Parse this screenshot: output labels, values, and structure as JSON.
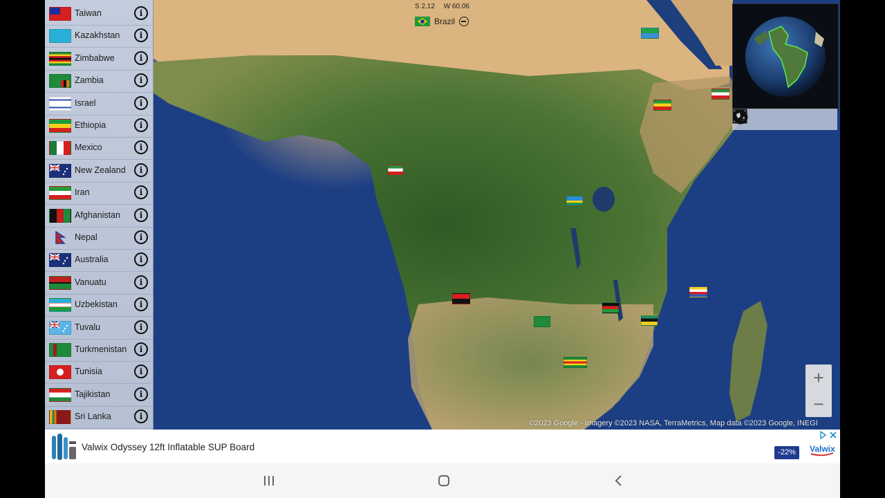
{
  "sidebar": {
    "countries": [
      {
        "name": "Taiwan",
        "flag": "taiwan-flag"
      },
      {
        "name": "Kazakhstan",
        "flag": "kazakhstan-flag"
      },
      {
        "name": "Zimbabwe",
        "flag": "zimbabwe-flag"
      },
      {
        "name": "Zambia",
        "flag": "zambia-flag"
      },
      {
        "name": "Israel",
        "flag": "israel-flag"
      },
      {
        "name": "Ethiopia",
        "flag": "ethiopia-flag"
      },
      {
        "name": "Mexico",
        "flag": "mexico-flag"
      },
      {
        "name": "New Zealand",
        "flag": "new-zealand-flag"
      },
      {
        "name": "Iran",
        "flag": "iran-flag"
      },
      {
        "name": "Afghanistan",
        "flag": "afghanistan-flag"
      },
      {
        "name": "Nepal",
        "flag": "nepal-flag"
      },
      {
        "name": "Australia",
        "flag": "australia-flag"
      },
      {
        "name": "Vanuatu",
        "flag": "vanuatu-flag"
      },
      {
        "name": "Uzbekistan",
        "flag": "uzbekistan-flag"
      },
      {
        "name": "Tuvalu",
        "flag": "tuvalu-flag"
      },
      {
        "name": "Turkmenistan",
        "flag": "turkmenistan-flag"
      },
      {
        "name": "Tunisia",
        "flag": "tunisia-flag"
      },
      {
        "name": "Tajikistan",
        "flag": "tajikistan-flag"
      },
      {
        "name": "Sri Lanka",
        "flag": "sri-lanka-flag"
      }
    ],
    "info_icon": "info-icon"
  },
  "coords": {
    "lat": "S 2.12",
    "lon": "W 60.06"
  },
  "current_country": {
    "name": "Brazil",
    "flag": "brazil-flag",
    "action_icon": "minus-circle-icon"
  },
  "globe_toolbar": {
    "icons": [
      "zoom-in-icon",
      "zoom-out-icon",
      "globe-icon",
      "search-icon"
    ]
  },
  "zoom": {
    "plus": "+",
    "minus": "−"
  },
  "attribution": "©2023 Google - Imagery ©2023 NASA, TerraMetrics, Map data ©2023 Google, INEGI",
  "ad": {
    "title": "Valwix Odyssey 12ft Inflatable SUP Board",
    "discount": "-22%",
    "brand_icon": "ad-logo-icon"
  },
  "nav": {
    "icons": [
      "recents-icon",
      "home-icon",
      "back-icon"
    ]
  },
  "colors": {
    "sidebar_bg": "#bcc5d7",
    "ocean": "#1c3f84",
    "land_green": "#3d6a2e",
    "desert": "#d9b27e",
    "discount_badge": "#1f3a8f"
  }
}
